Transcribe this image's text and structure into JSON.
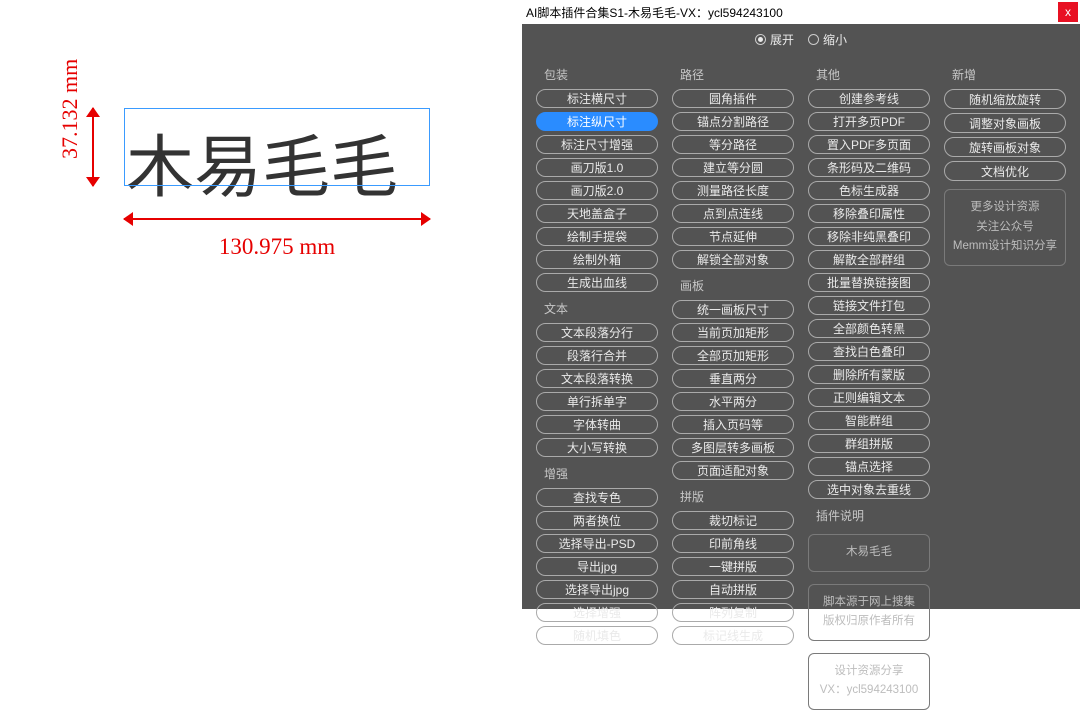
{
  "canvas": {
    "text": "木易毛毛",
    "dim_v": "37.132 mm",
    "dim_h": "130.975 mm"
  },
  "panel": {
    "title": "AI脚本插件合集S1-木易毛毛-VX：ycl594243100",
    "close": "x",
    "toggle": {
      "expand": "展开",
      "shrink": "缩小",
      "value": "expand"
    },
    "columns": [
      {
        "groups": [
          {
            "title": "包装",
            "buttons": [
              "标注横尺寸",
              "标注纵尺寸",
              "标注尺寸增强",
              "画刀版1.0",
              "画刀版2.0",
              "天地盖盒子",
              "绘制手提袋",
              "绘制外箱",
              "生成出血线"
            ],
            "active_index": 1
          },
          {
            "title": "文本",
            "buttons": [
              "文本段落分行",
              "段落行合并",
              "文本段落转换",
              "单行拆单字",
              "字体转曲",
              "大小写转换"
            ]
          },
          {
            "title": "增强",
            "buttons": [
              "查找专色",
              "两者换位",
              "选择导出-PSD",
              "导出jpg",
              "选择导出jpg",
              "选择增强",
              "随机填色"
            ]
          }
        ]
      },
      {
        "groups": [
          {
            "title": "路径",
            "buttons": [
              "圆角插件",
              "锚点分割路径",
              "等分路径",
              "建立等分圆",
              "测量路径长度",
              "点到点连线",
              "节点延伸",
              "解锁全部对象"
            ]
          },
          {
            "title": "画板",
            "buttons": [
              "统一画板尺寸",
              "当前页加矩形",
              "全部页加矩形",
              "垂直两分",
              "水平两分",
              "插入页码等",
              "多图层转多画板",
              "页面适配对象"
            ]
          },
          {
            "title": "拼版",
            "buttons": [
              "裁切标记",
              "印前角线",
              "一键拼版",
              "自动拼版",
              "阵列复制",
              "标记线生成"
            ]
          }
        ]
      },
      {
        "groups": [
          {
            "title": "其他",
            "buttons": [
              "创建参考线",
              "打开多页PDF",
              "置入PDF多页面",
              "条形码及二维码",
              "色标生成器",
              "移除叠印属性",
              "移除非纯黑叠印",
              "解散全部群组",
              "批量替换链接图",
              "链接文件打包",
              "全部颜色转黑",
              "查找白色叠印",
              "删除所有蒙版",
              "正则编辑文本",
              "智能群组",
              "群组拼版",
              "锚点选择",
              "选中对象去重线"
            ]
          },
          {
            "title": "插件说明",
            "info": [
              "木易毛毛",
              "脚本源于网上搜集\n版权归原作者所有",
              "设计资源分享\nVX：ycl594243100"
            ]
          }
        ]
      },
      {
        "groups": [
          {
            "title": "新增",
            "buttons": [
              "随机缩放旋转",
              "调整对象画板",
              "旋转画板对象",
              "文档优化"
            ]
          },
          {
            "title": "",
            "info": [
              "更多设计资源\n关注公众号\nMemm设计知识分享"
            ]
          }
        ]
      }
    ]
  }
}
